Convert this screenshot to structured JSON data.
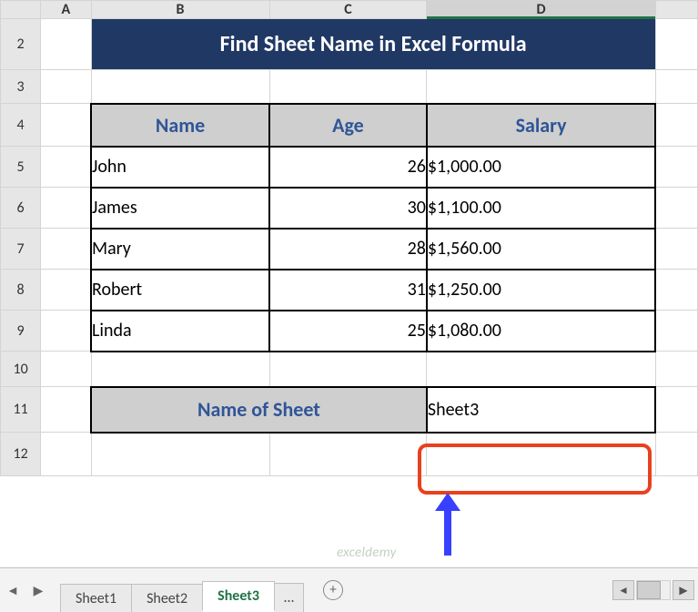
{
  "columns": {
    "A": "A",
    "B": "B",
    "C": "C",
    "D": "D"
  },
  "row_headers": [
    "2",
    "3",
    "4",
    "5",
    "6",
    "7",
    "8",
    "9",
    "10",
    "11",
    "12"
  ],
  "title": "Find Sheet Name in Excel Formula",
  "table": {
    "headers": {
      "name": "Name",
      "age": "Age",
      "salary": "Salary"
    },
    "rows": [
      {
        "name": "John",
        "age": "26",
        "currency": "$",
        "salary": "1,000.00"
      },
      {
        "name": "James",
        "age": "30",
        "currency": "$",
        "salary": "1,100.00"
      },
      {
        "name": "Mary",
        "age": "28",
        "currency": "$",
        "salary": "1,560.00"
      },
      {
        "name": "Robert",
        "age": "31",
        "currency": "$",
        "salary": "1,250.00"
      },
      {
        "name": "Linda",
        "age": "25",
        "currency": "$",
        "salary": "1,080.00"
      }
    ]
  },
  "sheet_label": "Name of Sheet",
  "sheet_result": "Sheet3",
  "tabs": {
    "sheet1": "Sheet1",
    "sheet2": "Sheet2",
    "sheet3": "Sheet3",
    "more": "…",
    "active": "sheet3"
  },
  "watermark": "exceldemy",
  "icons": {
    "nav_prev": "◄",
    "nav_next": "▶",
    "plus": "+",
    "scroll_left": "◄",
    "scroll_right": "▶"
  },
  "chart_data": {
    "type": "table",
    "title": "Find Sheet Name in Excel Formula",
    "columns": [
      "Name",
      "Age",
      "Salary"
    ],
    "rows": [
      [
        "John",
        26,
        1000.0
      ],
      [
        "James",
        30,
        1100.0
      ],
      [
        "Mary",
        28,
        1560.0
      ],
      [
        "Robert",
        31,
        1250.0
      ],
      [
        "Linda",
        25,
        1080.0
      ]
    ],
    "derived": {
      "Name of Sheet": "Sheet3"
    }
  }
}
